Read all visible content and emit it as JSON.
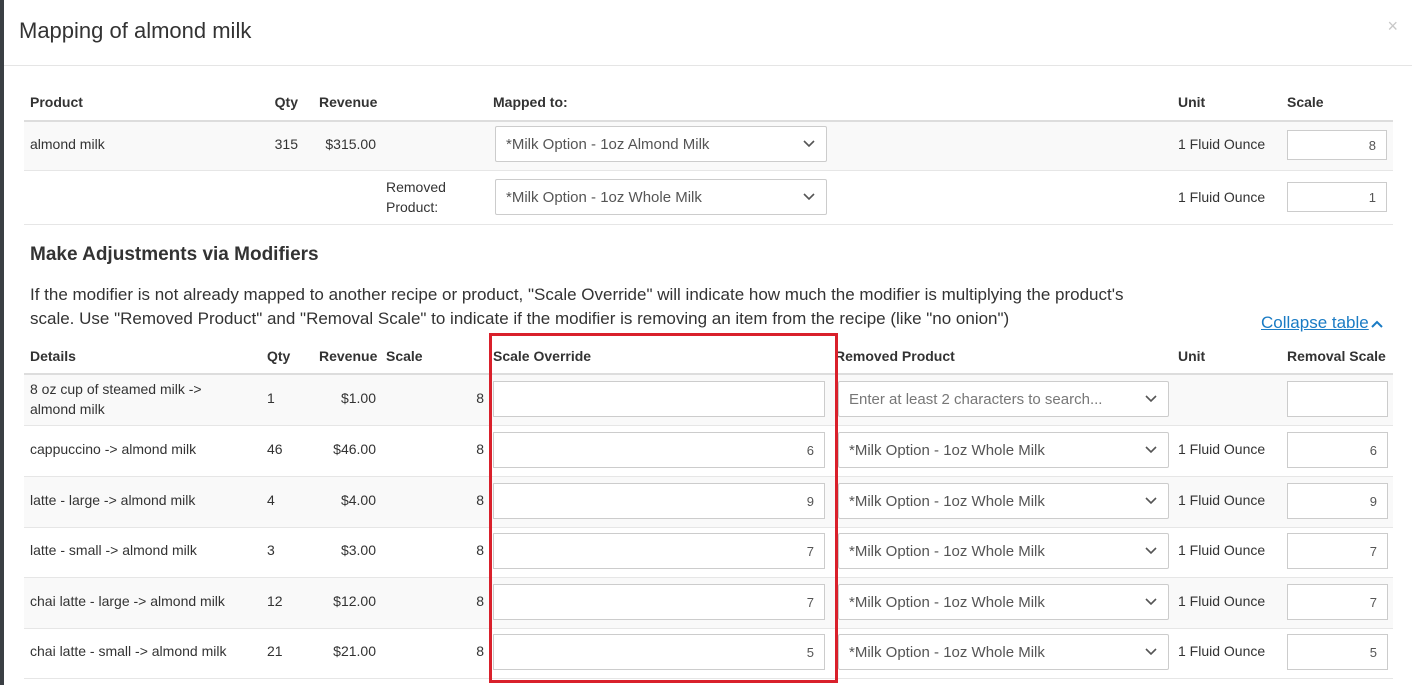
{
  "modal": {
    "title": "Mapping of almond milk",
    "close_label": "×"
  },
  "mapping_table": {
    "headers": {
      "product": "Product",
      "qty": "Qty",
      "revenue": "Revenue",
      "mapped_to": "Mapped to:",
      "unit": "Unit",
      "scale": "Scale"
    },
    "row": {
      "product": "almond milk",
      "qty": "315",
      "revenue": "$315.00",
      "mapped_to": "*Milk Option - 1oz Almond Milk",
      "unit": "1 Fluid Ounce",
      "scale": "8"
    },
    "removed_row": {
      "label": "Removed Product:",
      "mapped_to": "*Milk Option - 1oz Whole Milk",
      "unit": "1 Fluid Ounce",
      "scale": "1"
    }
  },
  "adjustments": {
    "title": "Make Adjustments via Modifiers",
    "help": "If the modifier is not already mapped to another recipe or product, \"Scale Override\" will indicate how much the modifier is multiplying the product's scale. Use \"Removed Product\" and \"Removal Scale\" to indicate if the modifier is removing an item from the recipe (like \"no onion\")",
    "collapse_label": "Collapse table",
    "headers": {
      "details": "Details",
      "qty": "Qty",
      "revenue": "Revenue",
      "scale": "Scale",
      "scale_override": "Scale Override",
      "removed_product": "Removed Product",
      "unit": "Unit",
      "removal_scale": "Removal Scale"
    },
    "rows": [
      {
        "details": "8 oz cup of steamed milk -> almond milk",
        "qty": "1",
        "revenue": "$1.00",
        "scale": "8",
        "scale_override": "",
        "removed_product": "",
        "removed_placeholder": "Enter at least 2 characters to search...",
        "unit": "",
        "removal_scale": ""
      },
      {
        "details": "cappuccino -> almond milk",
        "qty": "46",
        "revenue": "$46.00",
        "scale": "8",
        "scale_override": "6",
        "removed_product": "*Milk Option - 1oz Whole Milk",
        "unit": "1 Fluid Ounce",
        "removal_scale": "6"
      },
      {
        "details": "latte - large -> almond milk",
        "qty": "4",
        "revenue": "$4.00",
        "scale": "8",
        "scale_override": "9",
        "removed_product": "*Milk Option - 1oz Whole Milk",
        "unit": "1 Fluid Ounce",
        "removal_scale": "9"
      },
      {
        "details": "latte - small -> almond milk",
        "qty": "3",
        "revenue": "$3.00",
        "scale": "8",
        "scale_override": "7",
        "removed_product": "*Milk Option - 1oz Whole Milk",
        "unit": "1 Fluid Ounce",
        "removal_scale": "7"
      },
      {
        "details": "chai latte - large -> almond milk",
        "qty": "12",
        "revenue": "$12.00",
        "scale": "8",
        "scale_override": "7",
        "removed_product": "*Milk Option - 1oz Whole Milk",
        "unit": "1 Fluid Ounce",
        "removal_scale": "7"
      },
      {
        "details": "chai latte - small -> almond milk",
        "qty": "21",
        "revenue": "$21.00",
        "scale": "8",
        "scale_override": "5",
        "removed_product": "*Milk Option - 1oz Whole Milk",
        "unit": "1 Fluid Ounce",
        "removal_scale": "5"
      }
    ]
  },
  "icons": {
    "close": "close-icon",
    "dropdown": "chevron-down-icon",
    "collapse": "chevron-up-icon"
  },
  "colors": {
    "highlight": "#d9202b",
    "link": "#1a7bc4"
  }
}
